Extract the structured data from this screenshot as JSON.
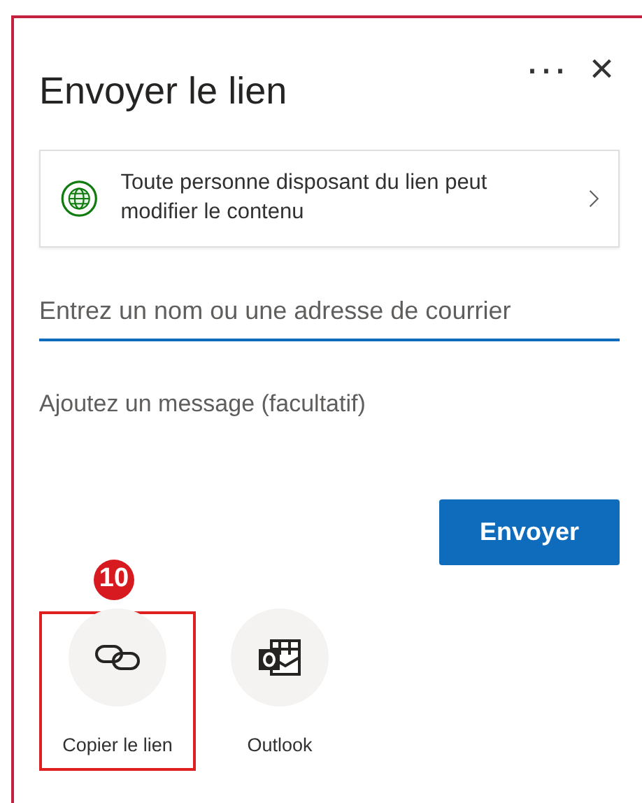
{
  "panel": {
    "title": "Envoyer le lien",
    "more_label": "···",
    "close_label": "×"
  },
  "permission": {
    "text": "Toute personne disposant du lien peut modifier le contenu"
  },
  "recipient": {
    "placeholder": "Entrez un nom ou une adresse de courrier",
    "focused": true
  },
  "message": {
    "placeholder": "Ajoutez un message (facultatif)"
  },
  "send_button": "Envoyer",
  "callout": {
    "number": "10"
  },
  "share_options": [
    {
      "kind": "copy-link",
      "label": "Copier le lien",
      "highlighted": true
    },
    {
      "kind": "outlook",
      "label": "Outlook",
      "highlighted": false
    }
  ]
}
